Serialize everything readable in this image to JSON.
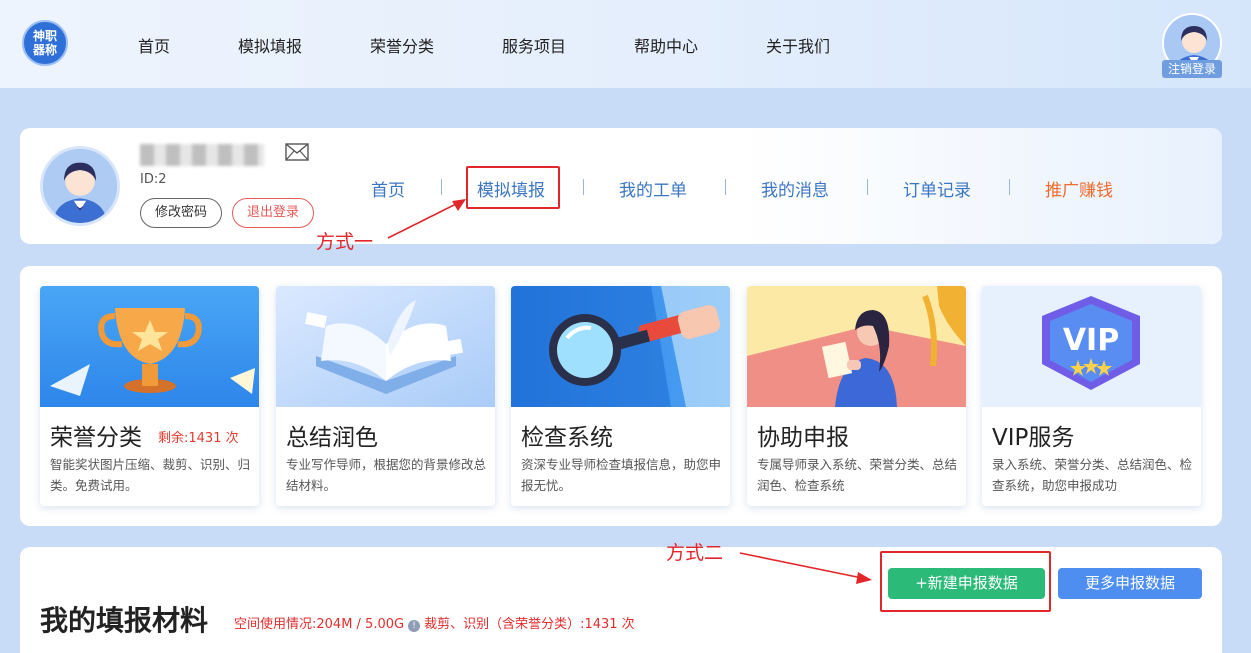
{
  "logo": {
    "text": "神职器称"
  },
  "nav": {
    "items": [
      {
        "label": "首页"
      },
      {
        "label": "模拟填报"
      },
      {
        "label": "荣誉分类"
      },
      {
        "label": "服务项目"
      },
      {
        "label": "帮助中心"
      },
      {
        "label": "关于我们"
      }
    ],
    "logout_label": "注销登录"
  },
  "profile": {
    "id_text": "ID:2",
    "change_password": "修改密码",
    "logout": "退出登录",
    "tabs": [
      {
        "label": "首页"
      },
      {
        "label": "模拟填报"
      },
      {
        "label": "我的工单"
      },
      {
        "label": "我的消息"
      },
      {
        "label": "订单记录"
      },
      {
        "label": "推广赚钱"
      }
    ]
  },
  "services": [
    {
      "title": "荣誉分类",
      "remaining": "剩余:1431 次",
      "desc": "智能奖状图片压缩、裁剪、识别、归类。免费试用。",
      "image": "trophy-illustration"
    },
    {
      "title": "总结润色",
      "desc": "专业写作导师，根据您的背景修改总结材料。",
      "image": "open-book-illustration"
    },
    {
      "title": "检查系统",
      "desc": "资深专业导师检查填报信息，助您申报无忧。",
      "image": "magnifier-illustration"
    },
    {
      "title": "协助申报",
      "desc": "专属导师录入系统、荣誉分类、总结润色、检查系统",
      "image": "reading-woman-illustration"
    },
    {
      "title": "VIP服务",
      "desc": "录入系统、荣誉分类、总结润色、检查系统，助您申报成功",
      "image": "vip-badge-illustration"
    }
  ],
  "materials": {
    "title": "我的填报材料",
    "usage_prefix": "空间使用情况:204M / 5.00G",
    "usage_suffix": "裁剪、识别（含荣誉分类）:1431 次",
    "new_button": "+新建申报数据",
    "more_button": "更多申报数据"
  },
  "annotations": {
    "method1": "方式一",
    "method2": "方式二"
  },
  "colors": {
    "accent": "#3c76c2",
    "promo": "#ef6b2c",
    "annotation_red": "#e3262a",
    "green_button": "#2bba78",
    "blue_button": "#4d8ef0"
  }
}
